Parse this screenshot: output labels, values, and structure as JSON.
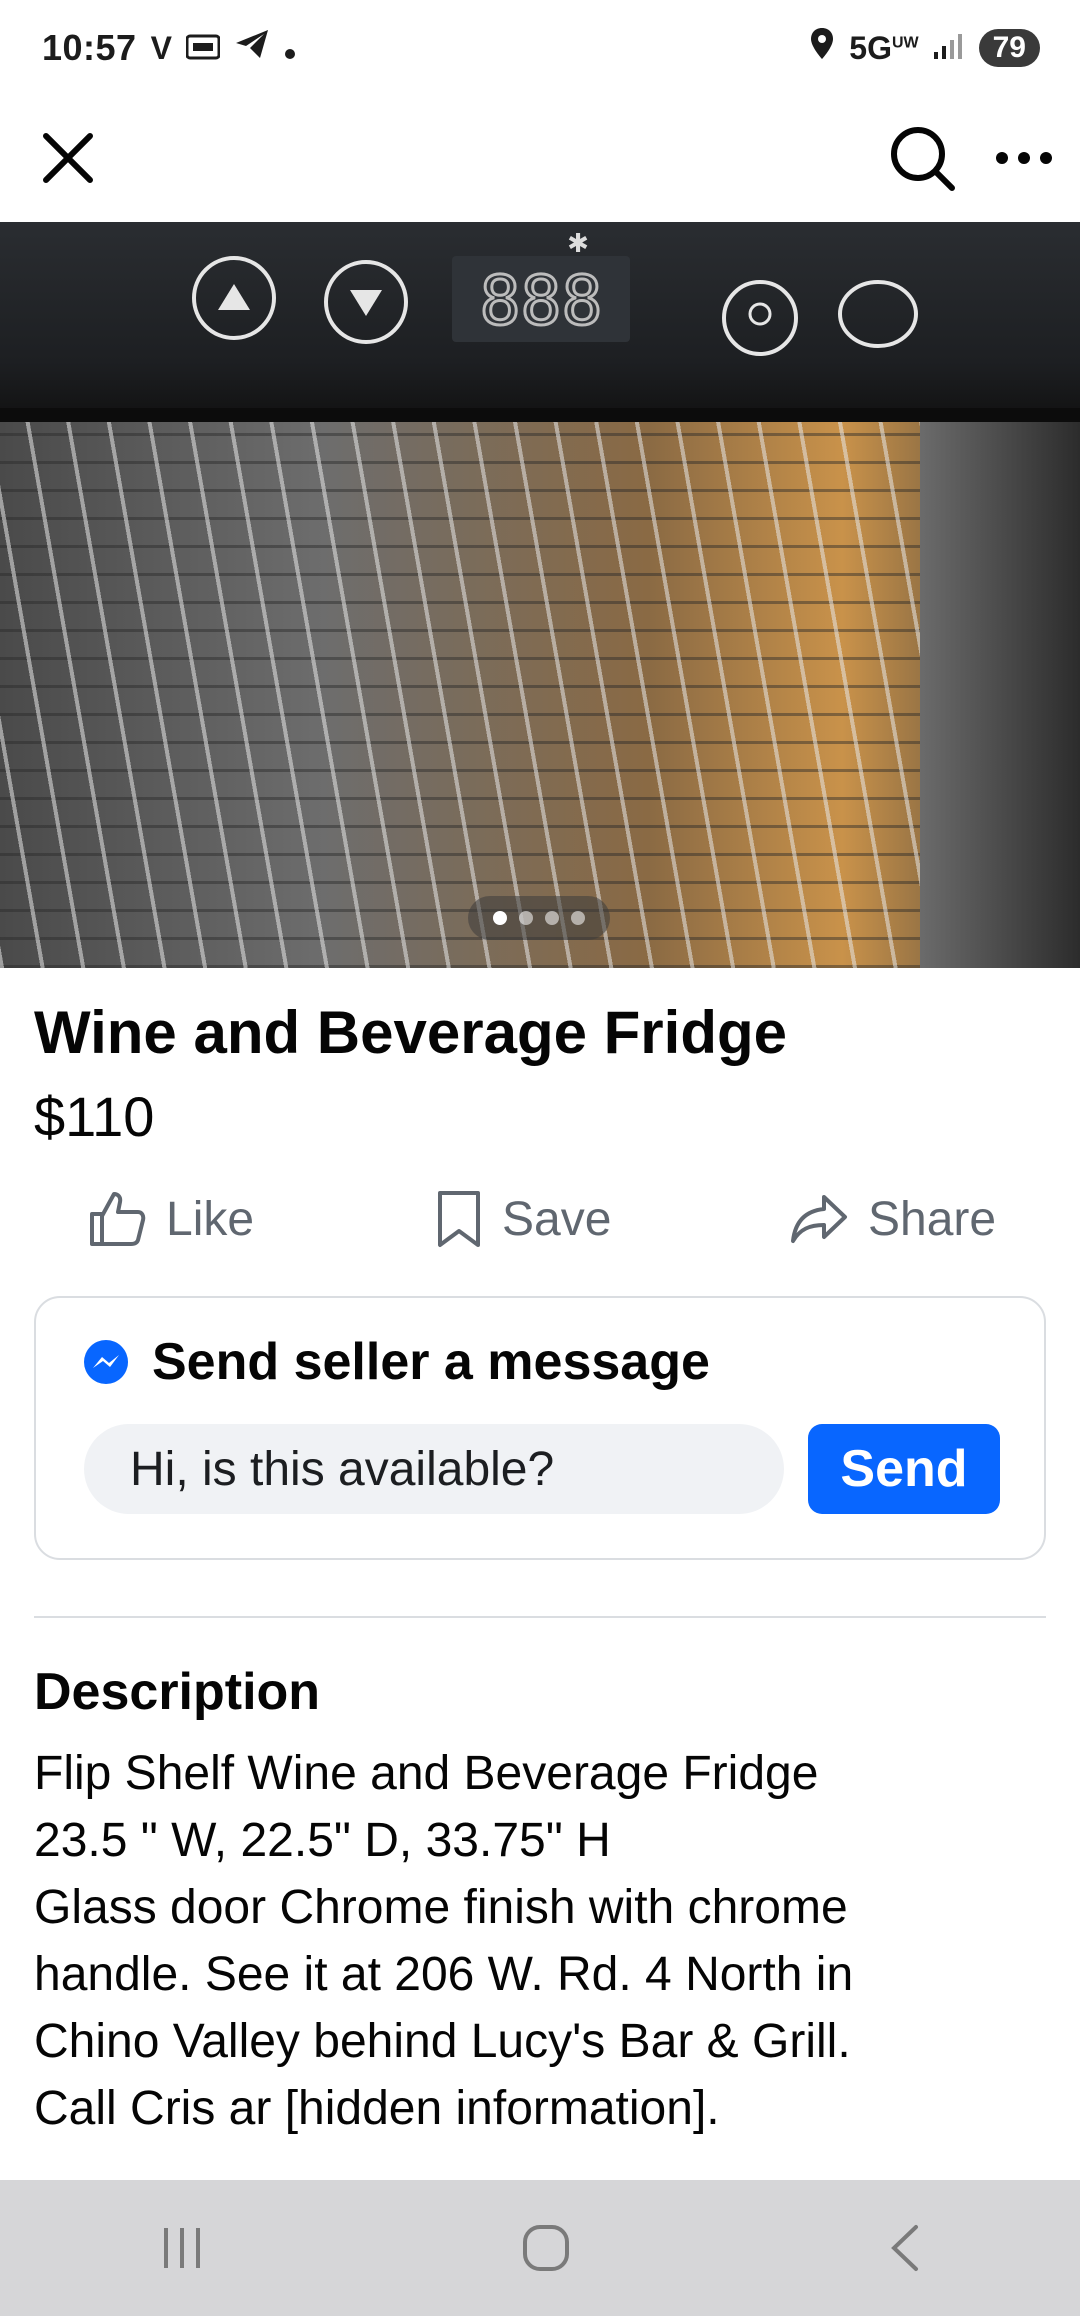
{
  "status_bar": {
    "time": "10:57",
    "carrier_glyph": "V",
    "network": "5G",
    "network_superscript": "UW",
    "battery": "79",
    "icons": [
      "voicemail-icon",
      "telegram-icon",
      "location-icon",
      "signal-icon"
    ]
  },
  "listing": {
    "title": "Wine and Beverage Fridge",
    "price": "$110",
    "image_count": 4,
    "active_image_index": 0,
    "hero_display": "888"
  },
  "actions": {
    "like": "Like",
    "save": "Save",
    "share": "Share"
  },
  "message": {
    "header": "Send seller a message",
    "input_value": "Hi, is this available?",
    "send_label": "Send"
  },
  "description": {
    "heading": "Description",
    "lines": [
      "Flip Shelf Wine and Beverage Fridge",
      "23.5 \" W,  22.5\" D, 33.75\" H",
      "Glass door Chrome finish with chrome",
      "handle.  See it at 206 W. Rd. 4 North in",
      "Chino Valley behind Lucy's Bar & Grill.",
      "Call Cris ar [hidden information]."
    ]
  },
  "colors": {
    "accent_blue": "#0866ff",
    "muted_text": "#606770",
    "input_bg": "#f0f2f5",
    "border": "#dadde1",
    "nav_bg": "#d6d6d8"
  }
}
